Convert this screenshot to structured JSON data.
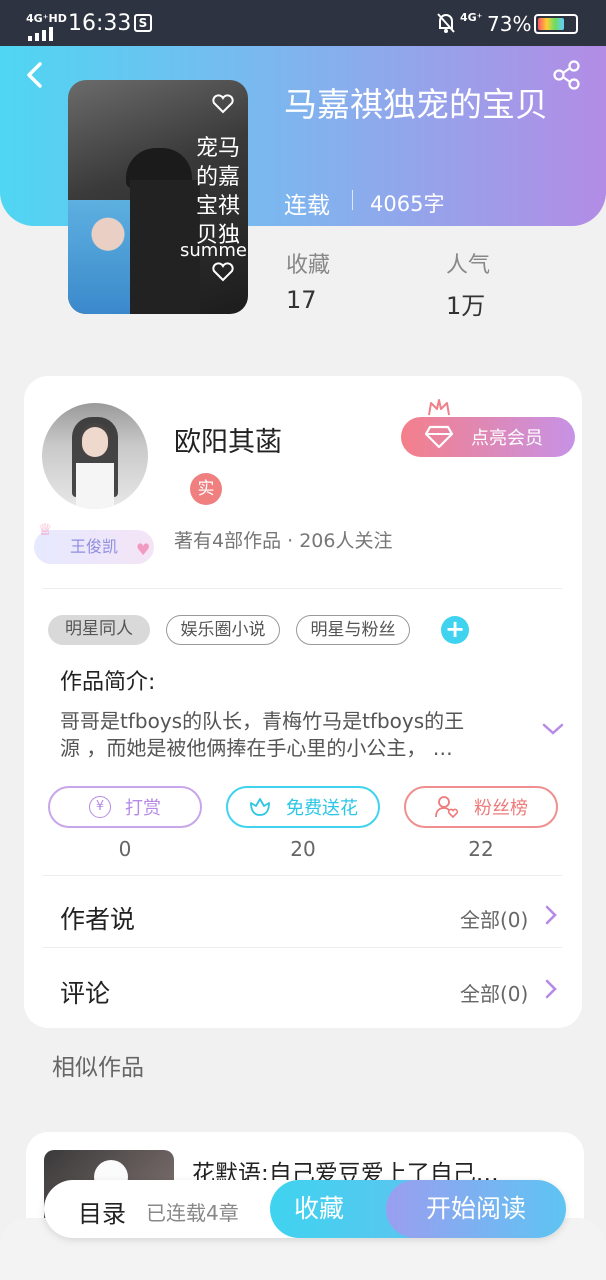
{
  "status_bar": {
    "network": "4G⁺HD",
    "time": "16:33",
    "network2": "4G⁺",
    "battery": "73%"
  },
  "book": {
    "title": "马嘉祺独宠的宝贝",
    "status": "连载",
    "word_count": "4065字",
    "favorites_label": "收藏",
    "favorites_value": "17",
    "popularity_label": "人气",
    "popularity_value": "1万"
  },
  "cover_text": {
    "line1": "宠马",
    "line2": "的嘉",
    "line3": "宝祺",
    "line4": "贝独",
    "overlay": "summe"
  },
  "author": {
    "name": "欧阳其菡",
    "verified": "实",
    "fan_badge": "王俊凯",
    "stats": "著有4部作品 · 206人关注",
    "vip_button": "点亮会员"
  },
  "tags": [
    "明星同人",
    "娱乐圈小说",
    "明星与粉丝"
  ],
  "intro": {
    "heading": "作品简介:",
    "text_line1": "哥哥是tfboys的队长，青梅竹马是tfboys的王",
    "text_line2": "源 ，而她是被他俩捧在手心里的小公主，  …"
  },
  "actions": [
    {
      "label": "打赏",
      "count": "0"
    },
    {
      "label": "免费送花",
      "count": "20"
    },
    {
      "label": "粉丝榜",
      "count": "22"
    }
  ],
  "author_says": {
    "label": "作者说",
    "all": "全部(0)"
  },
  "comments": {
    "label": "评论",
    "all": "全部(0)"
  },
  "similar": {
    "heading": "相似作品",
    "first_title": "花默语:自己爱豆爱上了自己…"
  },
  "bottom_bar": {
    "toc": "目录",
    "chapters": "已连载4章",
    "favorite": "收藏",
    "read": "开始阅读"
  },
  "colors": {
    "accent_purple": "#b68ae6",
    "accent_cyan": "#3fd3ef",
    "accent_pink": "#ef7f7f"
  }
}
